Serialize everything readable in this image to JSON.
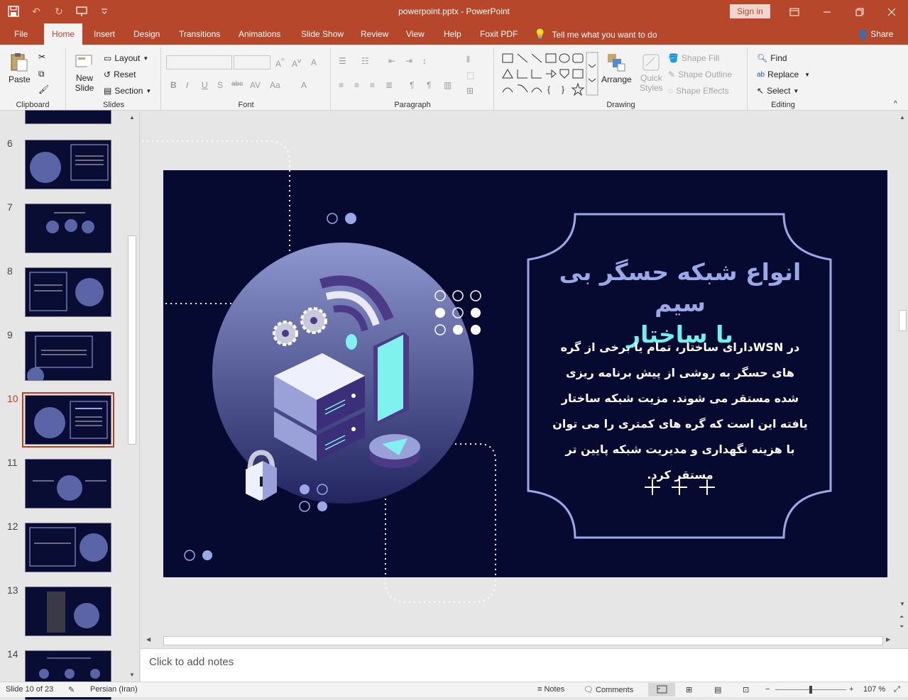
{
  "window": {
    "title": "powerpoint.pptx  -  PowerPoint",
    "sign_in": "Sign in"
  },
  "tabs": [
    "File",
    "Home",
    "Insert",
    "Design",
    "Transitions",
    "Animations",
    "Slide Show",
    "Review",
    "View",
    "Help",
    "Foxit PDF"
  ],
  "active_tab": "Home",
  "tell_me": "Tell me what you want to do",
  "share": "Share",
  "ribbon": {
    "clipboard": {
      "label": "Clipboard",
      "paste": "Paste"
    },
    "slides": {
      "label": "Slides",
      "new_slide": "New",
      "new_slide2": "Slide",
      "layout": "Layout",
      "reset": "Reset",
      "section": "Section"
    },
    "font": {
      "label": "Font"
    },
    "paragraph": {
      "label": "Paragraph"
    },
    "drawing": {
      "label": "Drawing",
      "arrange": "Arrange",
      "quick_styles": "Quick",
      "quick_styles2": "Styles",
      "shape_fill": "Shape Fill",
      "shape_outline": "Shape Outline",
      "shape_effects": "Shape Effects"
    },
    "editing": {
      "label": "Editing",
      "find": "Find",
      "replace": "Replace",
      "select": "Select"
    }
  },
  "thumbnails": [
    {
      "num": "6"
    },
    {
      "num": "7"
    },
    {
      "num": "8"
    },
    {
      "num": "9"
    },
    {
      "num": "10",
      "active": true
    },
    {
      "num": "11"
    },
    {
      "num": "12"
    },
    {
      "num": "13"
    },
    {
      "num": "14"
    }
  ],
  "slide": {
    "title_line1": "انواع شبکه حسگر بی سیم",
    "title_line2": "با ساختار",
    "body": "در WSNدارای ساختار، تمام یا برخی از گره های حسگر به روشی از پیش برنامه ریزی شده مستقر می شوند. مزیت شبکه ساختار یافته این است که گره های کمتری را می توان با هزینه نگهداری و مدیریت شبکه پایین تر مستقر کرد.",
    "colors": {
      "background": "#070a30",
      "title": "#9aa8e8",
      "subtitle": "#6ef2ee",
      "frame": "#9aa8e8"
    }
  },
  "notes_placeholder": "Click to add notes",
  "status": {
    "slide_count": "Slide 10 of 23",
    "language": "Persian (Iran)",
    "notes": "Notes",
    "comments": "Comments",
    "zoom": "107 %"
  }
}
